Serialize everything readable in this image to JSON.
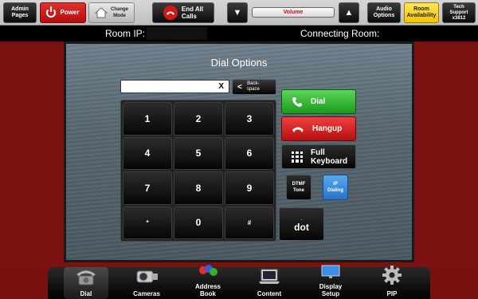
{
  "topbar": {
    "admin_pages": "Admin\nPages",
    "power": "Power",
    "change_mode": "Change\nMode",
    "end_all_calls": "End All\nCalls",
    "volume_label": "Volume",
    "volume_level": 0.0,
    "audio_options": "Audio\nOptions",
    "room_availability": "Room\nAvailability",
    "tech_support": "Tech\nSupport\nx3812"
  },
  "status": {
    "room_ip_label": "Room IP:",
    "connecting_room_label": "Connecting Room:"
  },
  "dialog": {
    "title": "Dial Options",
    "input_value": "",
    "clear_label": "X",
    "backspace_label": "Back-\nspace",
    "keys": [
      "1",
      "2",
      "3",
      "4",
      "5",
      "6",
      "7",
      "8",
      "9",
      "*",
      "0",
      "#"
    ],
    "dot_small": ".",
    "dot_label": "dot",
    "dial_label": "Dial",
    "hangup_label": "Hangup",
    "keyboard_label": "Full\nKeyboard",
    "dtmf_label": "DTMF\nTone",
    "ip_label": "IP\nDialing"
  },
  "nav": {
    "dial": "Dial",
    "cameras": "Cameras",
    "address_book": "Address\nBook",
    "content": "Content",
    "display_setup": "Display\nSetup",
    "pip": "PIP"
  },
  "colors": {
    "background_red": "#7a1010",
    "dial_green": "#1c9a1c",
    "hangup_red": "#c41010",
    "ip_blue": "#3a88e0",
    "room_yellow": "#f3c400"
  }
}
